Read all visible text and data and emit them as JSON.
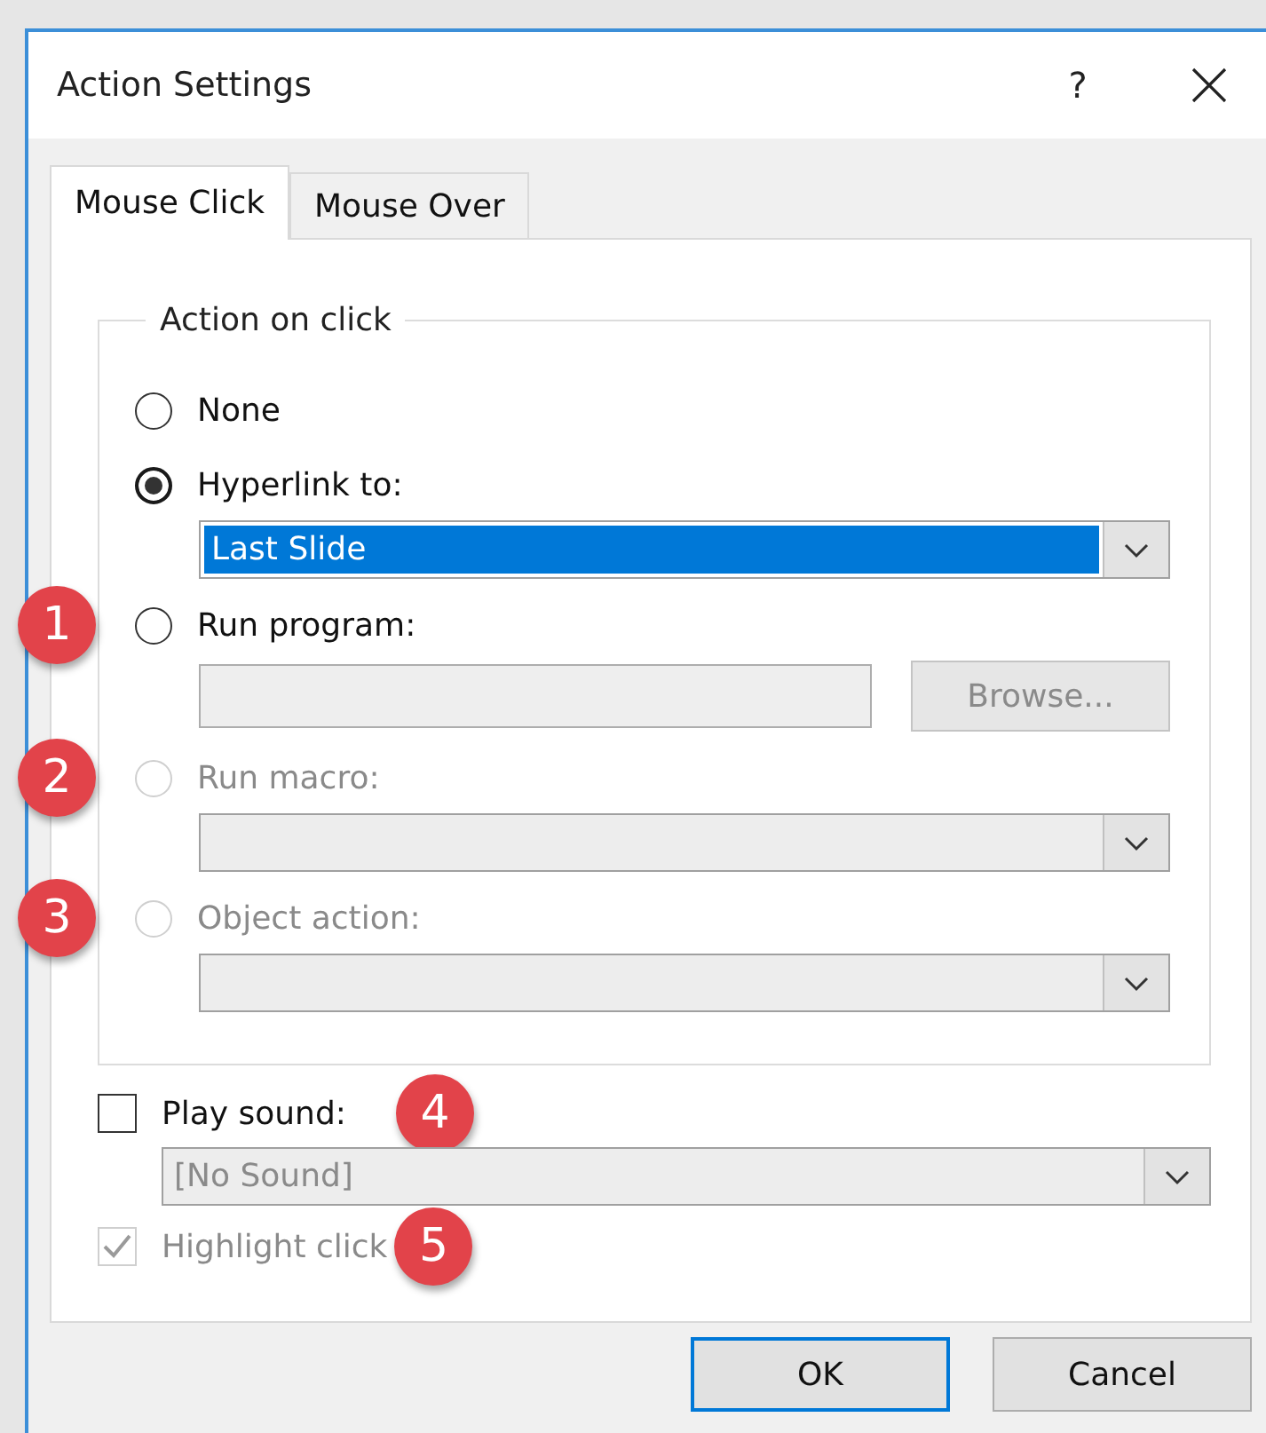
{
  "window": {
    "title": "Action Settings",
    "help": "?"
  },
  "tabs": [
    {
      "label": "Mouse Click",
      "selected": true
    },
    {
      "label": "Mouse Over",
      "selected": false
    }
  ],
  "group": {
    "title": "Action on click"
  },
  "options": [
    {
      "label": "None",
      "selected": false,
      "disabled": false
    },
    {
      "label": "Hyperlink to:",
      "selected": true,
      "disabled": false,
      "control": {
        "kind": "dropdown",
        "value": "Last Slide",
        "highlighted": true,
        "disabled": false
      }
    },
    {
      "label": "Run program:",
      "selected": false,
      "disabled": false,
      "badge": "1",
      "control": {
        "kind": "field",
        "disabled": true,
        "button": "Browse..."
      }
    },
    {
      "label": "Run macro:",
      "selected": false,
      "disabled": true,
      "badge": "2",
      "control": {
        "kind": "dropdown",
        "disabled": true
      }
    },
    {
      "label": "Object action:",
      "selected": false,
      "disabled": true,
      "badge": "3",
      "control": {
        "kind": "dropdown",
        "disabled": true
      }
    }
  ],
  "play_sound": {
    "label": "Play sound:",
    "checked": false,
    "disabled": false,
    "badge": "4",
    "sound": {
      "value": "[No Sound]",
      "disabled": true
    }
  },
  "highlight_click": {
    "label": "Highlight click",
    "checked": true,
    "disabled": true,
    "badge": "5"
  },
  "buttons": [
    {
      "label": "OK",
      "default": true
    },
    {
      "label": "Cancel",
      "default": false
    }
  ]
}
